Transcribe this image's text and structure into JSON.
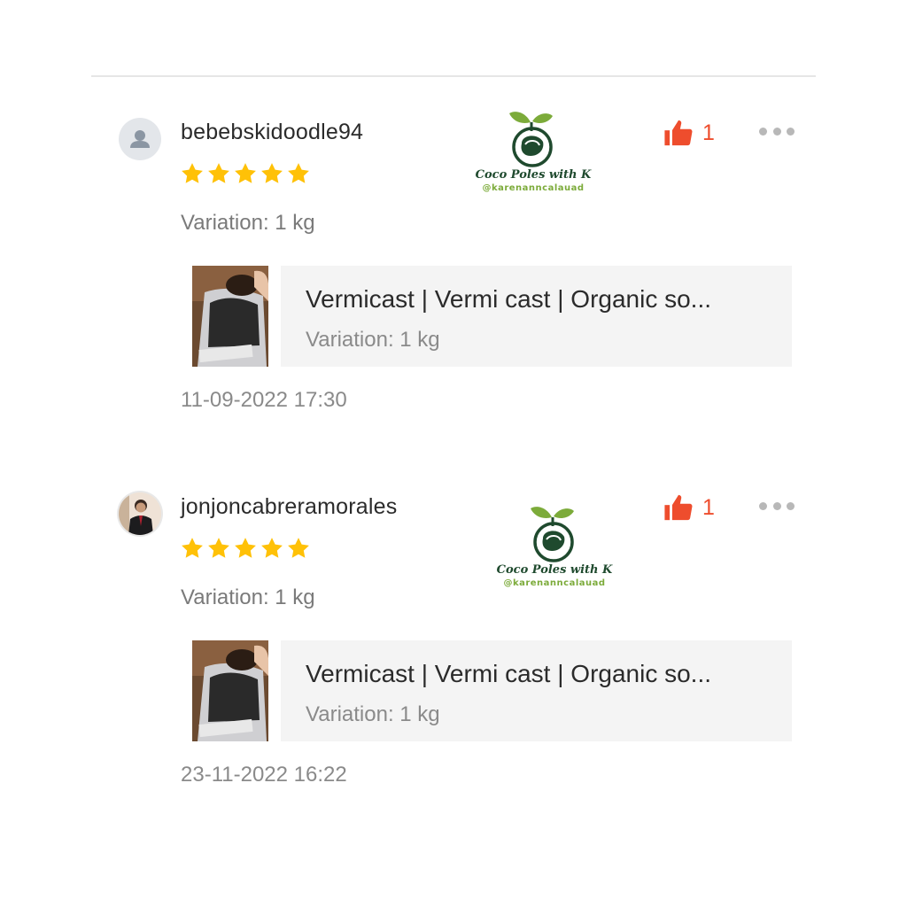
{
  "reviews": [
    {
      "username": "bebebskidoodle94",
      "avatar": "default-user-icon",
      "rating": 5,
      "variation": "Variation: 1 kg",
      "likes": "1",
      "product": {
        "name": "Vermicast | Vermi cast | Organic so...",
        "variation": "Variation: 1 kg"
      },
      "timestamp": "11-09-2022 17:30",
      "watermark": {
        "title": "Coco Poles with K",
        "handle": "@karenanncalauad"
      }
    },
    {
      "username": "jonjoncabreramorales",
      "avatar": "user-photo",
      "rating": 5,
      "variation": "Variation: 1 kg",
      "likes": "1",
      "product": {
        "name": "Vermicast | Vermi cast | Organic so...",
        "variation": "Variation: 1 kg"
      },
      "timestamp": "23-11-2022 16:22",
      "watermark": {
        "title": "Coco Poles with K",
        "handle": "@karenanncalauad"
      }
    }
  ],
  "colors": {
    "accent": "#ee4d2d",
    "star": "#ffc107",
    "text_primary": "#2b2b2b",
    "text_secondary": "#8a8a8a",
    "product_bg": "#f4f4f4",
    "watermark_green": "#1f4a2e",
    "watermark_lime": "#7cab3a"
  }
}
